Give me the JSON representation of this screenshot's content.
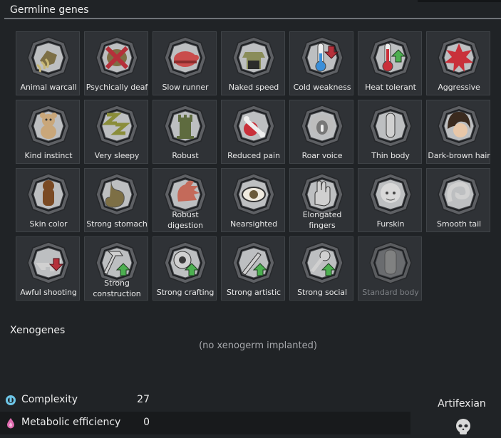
{
  "header": {
    "title": "Germline genes"
  },
  "genes": [
    {
      "label": "Animal warcall",
      "icon": "animal-warcall-icon",
      "col": 0,
      "row": 0
    },
    {
      "label": "Psychically deaf",
      "icon": "psychically-deaf-icon",
      "col": 1,
      "row": 0
    },
    {
      "label": "Slow runner",
      "icon": "slow-runner-icon",
      "col": 2,
      "row": 0
    },
    {
      "label": "Naked speed",
      "icon": "naked-speed-icon",
      "col": 3,
      "row": 0
    },
    {
      "label": "Cold weakness",
      "icon": "cold-weakness-icon",
      "col": 4,
      "row": 0
    },
    {
      "label": "Heat tolerant",
      "icon": "heat-tolerant-icon",
      "col": 5,
      "row": 0
    },
    {
      "label": "Aggressive",
      "icon": "aggressive-icon",
      "col": 6,
      "row": 0
    },
    {
      "label": "Kind instinct",
      "icon": "kind-instinct-icon",
      "col": 0,
      "row": 1
    },
    {
      "label": "Very sleepy",
      "icon": "very-sleepy-icon",
      "col": 1,
      "row": 1
    },
    {
      "label": "Robust",
      "icon": "robust-icon",
      "col": 2,
      "row": 1
    },
    {
      "label": "Reduced pain",
      "icon": "reduced-pain-icon",
      "col": 3,
      "row": 1
    },
    {
      "label": "Roar voice",
      "icon": "roar-voice-icon",
      "col": 4,
      "row": 1
    },
    {
      "label": "Thin body",
      "icon": "thin-body-icon",
      "col": 5,
      "row": 1
    },
    {
      "label": "Dark-brown hair",
      "icon": "dark-brown-hair-icon",
      "col": 6,
      "row": 1
    },
    {
      "label": "Skin color",
      "icon": "skin-color-icon",
      "col": 0,
      "row": 2
    },
    {
      "label": "Strong stomach",
      "icon": "strong-stomach-icon",
      "col": 1,
      "row": 2
    },
    {
      "label": "Robust digestion",
      "icon": "robust-digestion-icon",
      "col": 2,
      "row": 2,
      "two": true
    },
    {
      "label": "Nearsighted",
      "icon": "nearsighted-icon",
      "col": 3,
      "row": 2
    },
    {
      "label": "Elongated fingers",
      "icon": "elongated-fingers-icon",
      "col": 4,
      "row": 2,
      "two": true
    },
    {
      "label": "Furskin",
      "icon": "furskin-icon",
      "col": 5,
      "row": 2
    },
    {
      "label": "Smooth tail",
      "icon": "smooth-tail-icon",
      "col": 6,
      "row": 2
    },
    {
      "label": "Awful shooting",
      "icon": "awful-shooting-icon",
      "col": 0,
      "row": 3
    },
    {
      "label": "Strong construction",
      "icon": "strong-construction-icon",
      "col": 1,
      "row": 3,
      "two": true
    },
    {
      "label": "Strong crafting",
      "icon": "strong-crafting-icon",
      "col": 2,
      "row": 3
    },
    {
      "label": "Strong artistic",
      "icon": "strong-artistic-icon",
      "col": 3,
      "row": 3
    },
    {
      "label": "Strong social",
      "icon": "strong-social-icon",
      "col": 4,
      "row": 3
    },
    {
      "label": "Standard body",
      "icon": "standard-body-icon",
      "col": 5,
      "row": 3,
      "disabled": true
    }
  ],
  "xenogenes": {
    "title": "Xenogenes",
    "empty_text": "(no xenogerm implanted)"
  },
  "stats": [
    {
      "name": "Complexity",
      "value": "27",
      "icon": "complexity-icon",
      "color": "#6ec6e8"
    },
    {
      "name": "Metabolic efficiency",
      "value": "0",
      "icon": "metabolic-efficiency-icon",
      "color": "#e06cb0"
    }
  ],
  "xenotype": {
    "name": "Artifexian",
    "icon": "xenotype-skull-icon"
  },
  "colors": {
    "green_arrow": "#4caf50",
    "red_arrow": "#b5303a",
    "tile_bg": "#2f3236"
  }
}
